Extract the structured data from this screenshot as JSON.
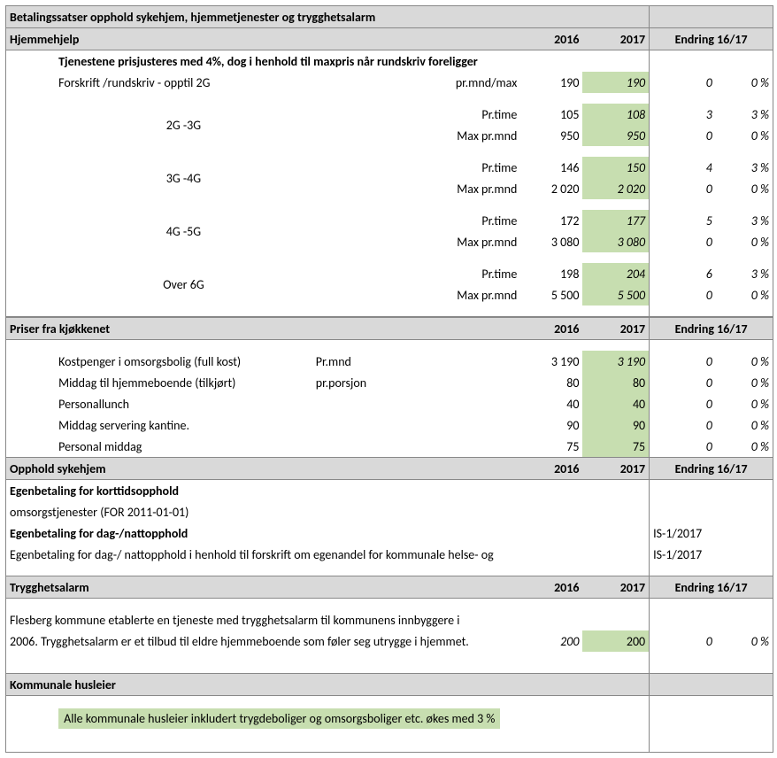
{
  "title": "Betalingssatser opphold sykehjem, hjemmetjenester og trygghetsalarm",
  "cols": {
    "y2016": "2016",
    "y2017": "2017",
    "change": "Endring 16/17"
  },
  "hjemmehjelp": {
    "label": "Hjemmehjelp",
    "intro": "Tjenestene prisjusteres med 4%, dog i henhold til maxpris når rundskriv foreligger",
    "r0": {
      "label": "Forskrift /rundskriv  - opptil 2G",
      "unit": "pr.mnd/max",
      "v2016": "190",
      "v2017": "190",
      "diff": "0",
      "pct": "0 %"
    },
    "groups": [
      {
        "label": "2G -3G",
        "r1": {
          "unit": "Pr.time",
          "v2016": "105",
          "v2017": "108",
          "diff": "3",
          "pct": "3 %"
        },
        "r2": {
          "unit": "Max pr.mnd",
          "v2016": "950",
          "v2017": "950",
          "diff": "0",
          "pct": "0 %"
        }
      },
      {
        "label": "3G -4G",
        "r1": {
          "unit": "Pr.time",
          "v2016": "146",
          "v2017": "150",
          "diff": "4",
          "pct": "3 %"
        },
        "r2": {
          "unit": "Max pr.mnd",
          "v2016": "2 020",
          "v2017": "2 020",
          "diff": "0",
          "pct": "0 %"
        }
      },
      {
        "label": "4G -5G",
        "r1": {
          "unit": "Pr.time",
          "v2016": "172",
          "v2017": "177",
          "diff": "5",
          "pct": "3 %"
        },
        "r2": {
          "unit": "Max pr.mnd",
          "v2016": "3 080",
          "v2017": "3 080",
          "diff": "0",
          "pct": "0 %"
        }
      },
      {
        "label": "Over 6G",
        "r1": {
          "unit": "Pr.time",
          "v2016": "198",
          "v2017": "204",
          "diff": "6",
          "pct": "3 %"
        },
        "r2": {
          "unit": "Max pr.mnd",
          "v2016": "5 500",
          "v2017": "5 500",
          "diff": "0",
          "pct": "0 %"
        }
      }
    ]
  },
  "kjokken": {
    "label": "Priser fra kjøkkenet",
    "rows": [
      {
        "label": "Kostpenger i omsorgsbolig (full kost)",
        "unit": "Pr.mnd",
        "v2016": "3 190",
        "v2017": "3 190",
        "diff": "0",
        "pct": "0 %",
        "ital": true
      },
      {
        "label": "Middag til hjemmeboende (tilkjørt)",
        "unit": "pr.porsjon",
        "v2016": "80",
        "v2017": "80",
        "diff": "0",
        "pct": "0 %"
      },
      {
        "label": "Personallunch",
        "unit": "",
        "v2016": "40",
        "v2017": "40",
        "diff": "0",
        "pct": "0 %"
      },
      {
        "label": "Middag servering kantine.",
        "unit": "",
        "v2016": "90",
        "v2017": "90",
        "diff": "0",
        "pct": "0 %"
      },
      {
        "label": "Personal middag",
        "unit": "",
        "v2016": "75",
        "v2017": "75",
        "diff": "0",
        "pct": "0 %"
      }
    ]
  },
  "sykehjem": {
    "label": "Opphold sykehjem",
    "line1": "Egenbetaling for korttidsopphold",
    "line2": "omsorgstjenester (FOR 2011-01-01)",
    "line3": "Egenbetaling for  dag-/nattopphold",
    "line4": "Egenbetaling for  dag-/ nattopphold i henhold til forskrift om egenandel for kommunale helse- og",
    "ref": "IS-1/2017"
  },
  "trygghet": {
    "label": "Trygghetsalarm",
    "text1": "Flesberg kommune etablerte en tjeneste med trygghetsalarm til kommunens innbyggere i",
    "text2": "2006.  Trygghetsalarm er et tilbud til eldre hjemmeboende som føler seg utrygge i hjemmet.",
    "v2016": "200",
    "v2017": "200",
    "diff": "0",
    "pct": "0 %"
  },
  "husleier": {
    "label": "Kommunale husleier",
    "note": "Alle kommunale husleier inkludert trygdeboliger og omsorgsboliger etc. økes med 3 %"
  }
}
